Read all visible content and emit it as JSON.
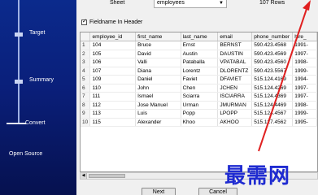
{
  "sidebar": {
    "steps": [
      {
        "label": "Target"
      },
      {
        "label": "Summary"
      },
      {
        "label": "Convert"
      },
      {
        "label": "Open Source"
      }
    ]
  },
  "sheet": {
    "label": "Sheet",
    "selected": "employees",
    "rows_text": "107 Rows"
  },
  "header_option": {
    "label": "Fieldname In Header",
    "checked": true
  },
  "grid": {
    "columns": [
      "",
      "employee_id",
      "first_name",
      "last_name",
      "email",
      "phone_number",
      "hire_"
    ],
    "rows": [
      [
        "1",
        "104",
        "Bruce",
        "Ernst",
        "BERNST",
        "590.423.4568",
        "1991-"
      ],
      [
        "2",
        "105",
        "David",
        "Austin",
        "DAUSTIN",
        "590.423.4569",
        "1997-"
      ],
      [
        "3",
        "106",
        "Valli",
        "Pataballa",
        "VPATABAL",
        "590.423.4560",
        "1998-"
      ],
      [
        "4",
        "107",
        "Diana",
        "Lorentz",
        "DLORENTZ",
        "590.423.5567",
        "1999-"
      ],
      [
        "5",
        "109",
        "Daniel",
        "Faviet",
        "DFAVIET",
        "515.124.4169",
        "1994-"
      ],
      [
        "6",
        "110",
        "John",
        "Chen",
        "JCHEN",
        "515.124.4269",
        "1997-"
      ],
      [
        "7",
        "111",
        "Ismael",
        "Sciarra",
        "ISCIARRA",
        "515.124.4369",
        "1997-"
      ],
      [
        "8",
        "112",
        "Jose Manuel",
        "Urman",
        "JMURMAN",
        "515.124.4469",
        "1998-"
      ],
      [
        "9",
        "113",
        "Luis",
        "Popp",
        "LPOPP",
        "515.124.4567",
        "1999-"
      ],
      [
        "10",
        "115",
        "Alexander",
        "Khoo",
        "AKHOO",
        "515.127.4562",
        "1995-"
      ]
    ]
  },
  "buttons": {
    "next": "Next",
    "cancel": "Cancel"
  },
  "watermark": "最需网",
  "colors": {
    "sidebar": "#0a1f7a",
    "annotation_arrow": "#e02020",
    "watermark": "#1f2bd1"
  }
}
